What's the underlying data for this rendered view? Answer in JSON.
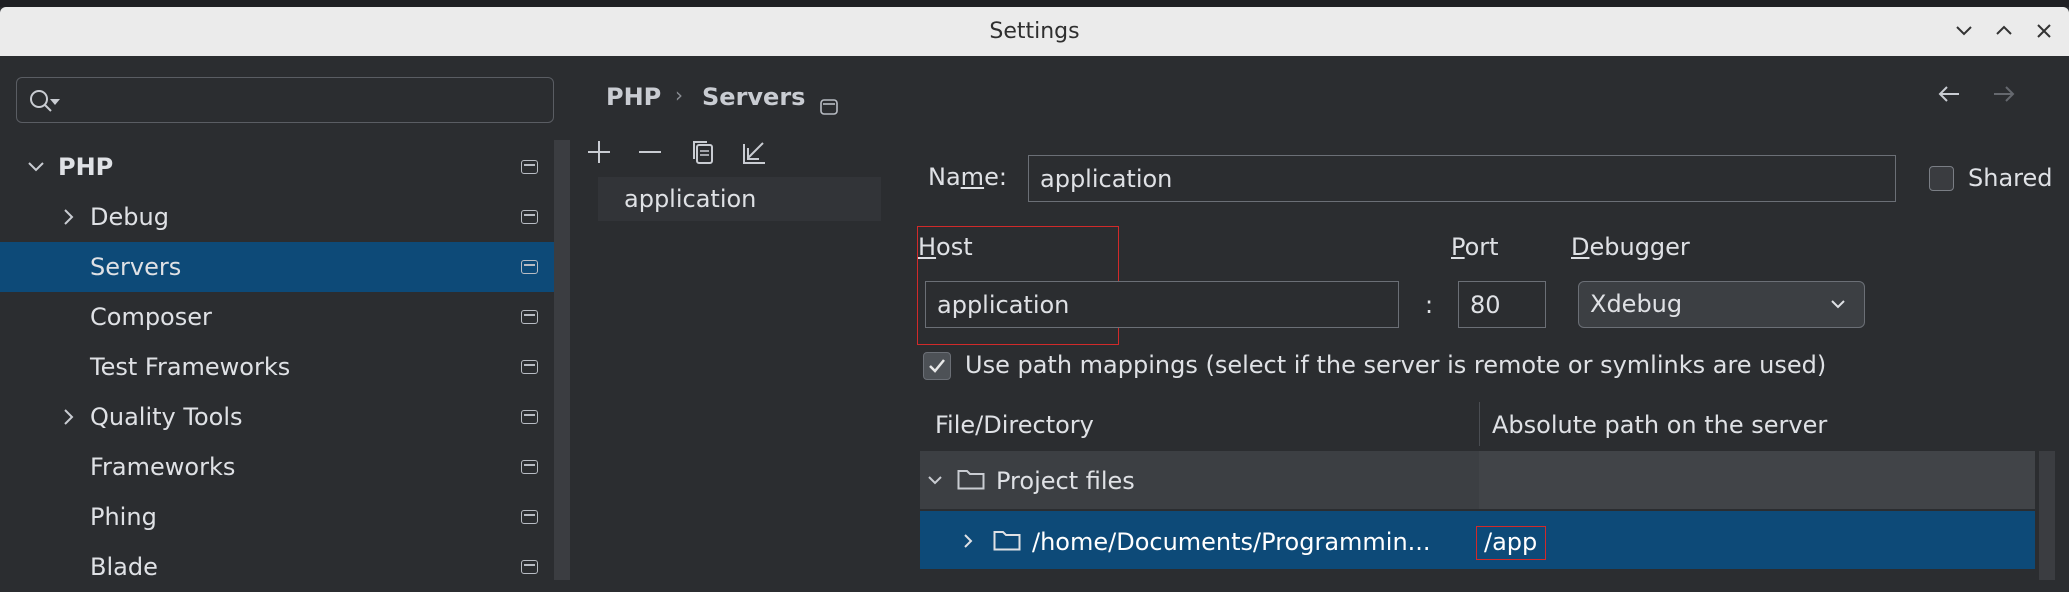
{
  "window": {
    "title": "Settings"
  },
  "search": {
    "placeholder": ""
  },
  "sidebar": {
    "items": [
      {
        "label": "PHP"
      },
      {
        "label": "Debug"
      },
      {
        "label": "Servers"
      },
      {
        "label": "Composer"
      },
      {
        "label": "Test Frameworks"
      },
      {
        "label": "Quality Tools"
      },
      {
        "label": "Frameworks"
      },
      {
        "label": "Phing"
      },
      {
        "label": "Blade"
      }
    ]
  },
  "breadcrumb": {
    "parent": "PHP",
    "separator": "›",
    "current": "Servers"
  },
  "server_list": {
    "items": [
      {
        "label": "application"
      }
    ]
  },
  "form": {
    "name_label": "Name:",
    "name_value": "application",
    "shared_label": "Shared",
    "shared_checked": false,
    "host_label": "Host",
    "host_value": "application",
    "colon": ":",
    "port_label": "Port",
    "port_value": "80",
    "debugger_label": "Debugger",
    "debugger_value": "Xdebug",
    "path_mappings_label": "Use path mappings (select if the server is remote or symlinks are used)",
    "path_mappings_checked": true
  },
  "mappings": {
    "columns": [
      "File/Directory",
      "Absolute path on the server"
    ],
    "rows": [
      {
        "file": "Project files",
        "path": ""
      },
      {
        "file": "/home/Documents/Programmin...",
        "path": "/app"
      }
    ]
  },
  "colors": {
    "background": "#2b2d30",
    "selection": "#0d4a78",
    "highlight_border": "#d12a2a"
  }
}
